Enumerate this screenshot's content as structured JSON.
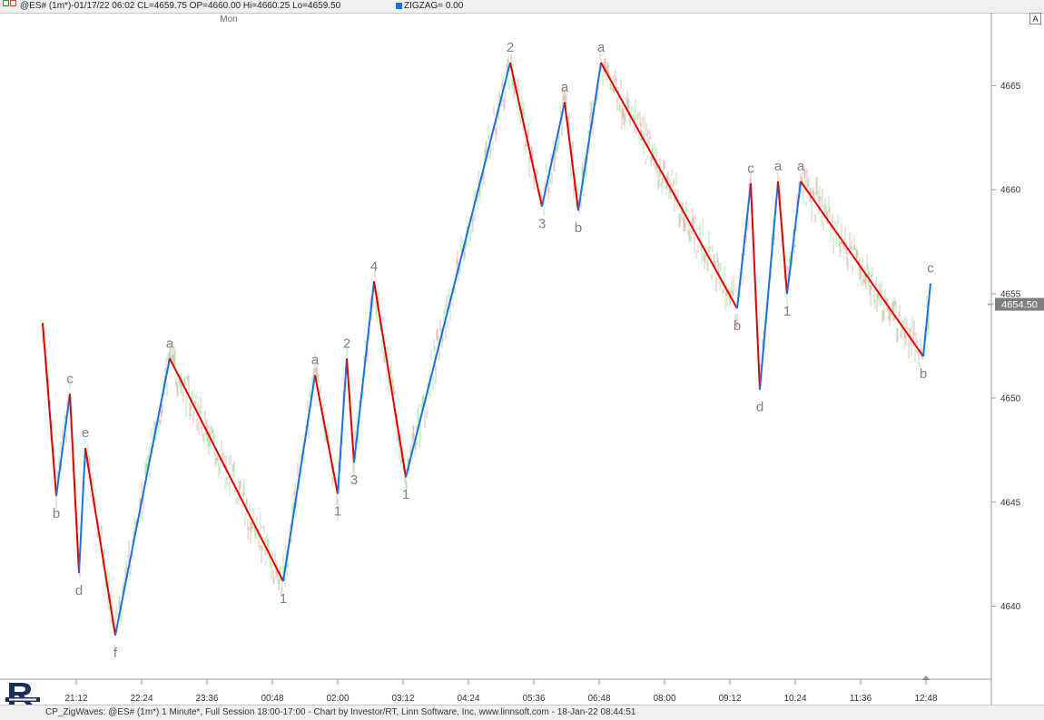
{
  "header": {
    "symbol_info": "@ES# (1m*)-01/17/22 06:02 CL=4659.75 OP=4660.00 Hi=4660.25 Lo=4659.50",
    "indicator": "ZIGZAG= 0.00",
    "day_label": "Mon",
    "button_label": "A"
  },
  "footer": {
    "text": "CP_ZigWaves: @ES# (1m*) 1 Minute*, Full Session 18:00-17:00 - Chart by Investor/RT, Linn Software, Inc. www.linnsoft.com - 18-Jan-22 08:44:51"
  },
  "colors": {
    "up_wave": "#1a73d9",
    "down_wave": "#dd0000",
    "up_bar": "#b5ecb5",
    "down_bar": "#ecbcbc",
    "label": "#808080",
    "price_box": "#7f7f7f"
  },
  "chart_data": {
    "type": "line",
    "title": "",
    "xlabel": "",
    "ylabel": "",
    "ylim": [
      4636.5,
      4668.5
    ],
    "y_ticks": [
      4640,
      4645,
      4650,
      4655,
      4660,
      4665
    ],
    "x_tick_labels": [
      "21:12",
      "22:24",
      "23:36",
      "00:48",
      "02:00",
      "03:12",
      "04:24",
      "05:36",
      "06:48",
      "08:00",
      "09:12",
      "10:24",
      "11:36",
      "12:48"
    ],
    "last_price": "4654.50",
    "last_price_value": 4654.5,
    "series": [
      {
        "points": [
          {
            "t": "20:35",
            "y": 4653.6
          },
          {
            "t": "20:50",
            "y": 4645.3,
            "label": "b"
          },
          {
            "t": "21:05",
            "y": 4650.2,
            "label": "c"
          },
          {
            "t": "21:15",
            "y": 4641.6,
            "label": "d"
          },
          {
            "t": "21:22",
            "y": 4647.6,
            "label": "e"
          },
          {
            "t": "21:55",
            "y": 4638.6,
            "label": "f"
          },
          {
            "t": "22:55",
            "y": 4651.9,
            "label": "a"
          },
          {
            "t": "01:00",
            "y": 4641.2,
            "label": "1"
          },
          {
            "t": "01:35",
            "y": 4651.1,
            "label": "a"
          },
          {
            "t": "02:00",
            "y": 4645.4,
            "label": "1"
          },
          {
            "t": "02:10",
            "y": 4651.9,
            "label": "2"
          },
          {
            "t": "02:18",
            "y": 4646.9,
            "label": "3"
          },
          {
            "t": "02:40",
            "y": 4655.6,
            "label": "4"
          },
          {
            "t": "03:15",
            "y": 4646.2,
            "label": "1"
          },
          {
            "t": "05:10",
            "y": 4666.1,
            "label": "2"
          },
          {
            "t": "05:45",
            "y": 4659.2,
            "label": "3"
          },
          {
            "t": "06:10",
            "y": 4664.2,
            "label": "a"
          },
          {
            "t": "06:25",
            "y": 4659.0,
            "label": "b"
          },
          {
            "t": "06:50",
            "y": 4666.1,
            "label": "a"
          },
          {
            "t": "09:20",
            "y": 4654.3,
            "label": "b"
          },
          {
            "t": "09:35",
            "y": 4660.3,
            "label": "c"
          },
          {
            "t": "09:45",
            "y": 4650.4,
            "label": "d"
          },
          {
            "t": "10:05",
            "y": 4660.4,
            "label": "a"
          },
          {
            "t": "10:15",
            "y": 4655.0,
            "label": "1"
          },
          {
            "t": "10:30",
            "y": 4660.4,
            "label": "a"
          },
          {
            "t": "12:45",
            "y": 4652.0,
            "label": "b"
          },
          {
            "t": "12:53",
            "y": 4655.5,
            "label": "c"
          }
        ]
      }
    ],
    "grid": false
  }
}
